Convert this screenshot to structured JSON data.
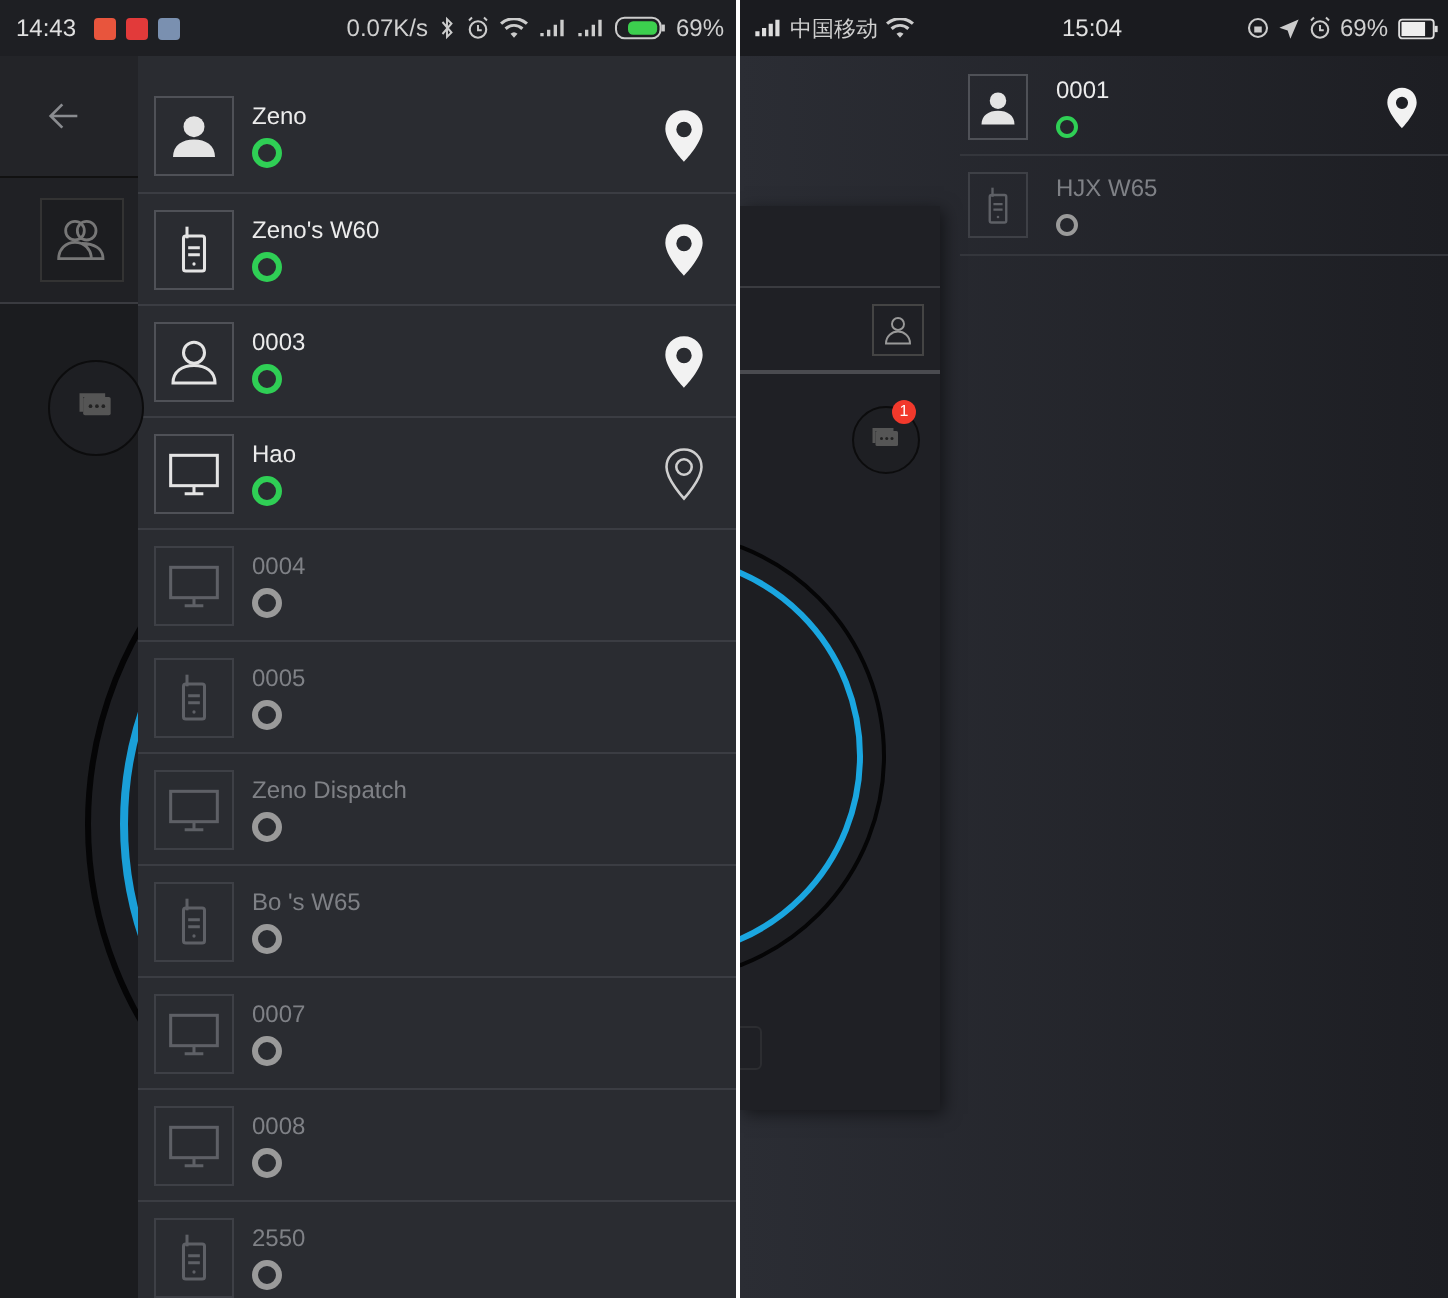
{
  "left_screen": {
    "status_bar": {
      "time": "14:43",
      "network_speed": "0.07K/s",
      "battery": "69%"
    },
    "contacts": [
      {
        "name": "Zeno",
        "kind": "person",
        "online": true,
        "location_pin": true,
        "pin_filled": true
      },
      {
        "name": "Zeno's W60",
        "kind": "radio",
        "online": true,
        "location_pin": true,
        "pin_filled": true
      },
      {
        "name": "0003",
        "kind": "person_outline",
        "online": true,
        "location_pin": true,
        "pin_filled": true
      },
      {
        "name": "Hao",
        "kind": "monitor",
        "online": true,
        "location_pin": true,
        "pin_filled": false
      },
      {
        "name": "0004",
        "kind": "monitor",
        "online": false,
        "location_pin": false
      },
      {
        "name": "0005",
        "kind": "radio",
        "online": false,
        "location_pin": false
      },
      {
        "name": "Zeno Dispatch",
        "kind": "monitor",
        "online": false,
        "location_pin": false
      },
      {
        "name": "Bo 's W65",
        "kind": "radio",
        "online": false,
        "location_pin": false
      },
      {
        "name": "0007",
        "kind": "monitor",
        "online": false,
        "location_pin": false
      },
      {
        "name": "0008",
        "kind": "monitor",
        "online": false,
        "location_pin": false
      },
      {
        "name": "2550",
        "kind": "radio",
        "online": false,
        "location_pin": false
      }
    ]
  },
  "right_screen": {
    "status_bar": {
      "carrier": "中国移动",
      "time": "15:04",
      "battery": "69%"
    },
    "background_app": {
      "unread_badge": "1"
    },
    "contacts": [
      {
        "name": "0001",
        "kind": "person",
        "online": true,
        "location_pin": true,
        "pin_filled": true
      },
      {
        "name": "HJX W65",
        "kind": "radio",
        "online": false,
        "location_pin": false
      }
    ]
  }
}
